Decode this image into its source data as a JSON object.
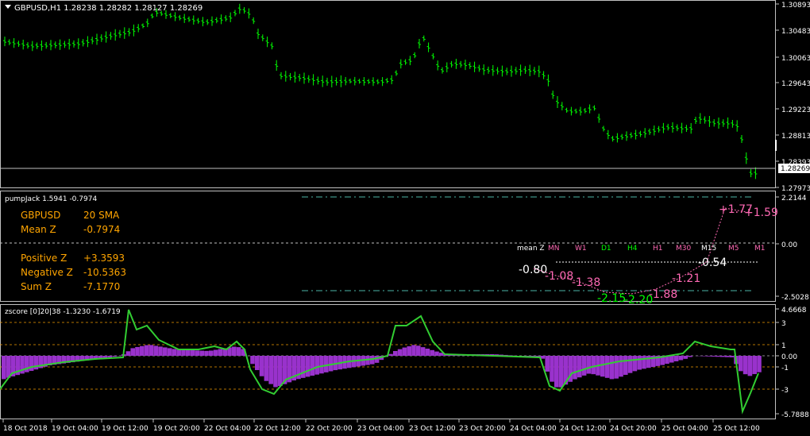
{
  "colors": {
    "background": "#000000",
    "candles": "#00ff00",
    "grid_border": "#c0c0c0",
    "orange_label": "#ffa500",
    "pink": "#ff69b4",
    "histogram": "#9932cc",
    "zscore_line": "#32cd32",
    "dashed_teal": "#4db3a6"
  },
  "main_chart": {
    "title": "GBPUSD,H1  1.28238 1.28282 1.28127 1.28269",
    "menu_icon": "triangle-down-icon",
    "price_ticks": [
      "1.30893",
      "1.30483",
      "1.30063",
      "1.29643",
      "1.29223",
      "1.28813",
      "1.28393",
      "1.27973"
    ],
    "current_price": "1.28269"
  },
  "pumpjack": {
    "title": "pumpJack 1.5941 -0.7974",
    "symbol": "GBPUSD",
    "sma": "20 SMA",
    "mean_label": "Mean Z",
    "mean_value": "-0.7974",
    "positive_label": "Positive Z",
    "positive_value": "+3.3593",
    "negative_label": "Negative Z",
    "negative_value": "-10.5363",
    "sum_label": "Sum Z",
    "sum_value": "-7.1770",
    "mean_z_header": "mean Z",
    "timeframes": [
      "MN",
      "W1",
      "D1",
      "H4",
      "H1",
      "M30",
      "M15",
      "M5",
      "M1"
    ],
    "mean_z_value": "-0.80",
    "tf_values": [
      "-1.08",
      "-1.38",
      "-2.15",
      "-2.20",
      "-1.88",
      "-1.21",
      "-0.54",
      "+1.77",
      "+1.59"
    ],
    "axis_ticks": [
      "2.2144",
      "0.00",
      "-2.5028"
    ]
  },
  "zscore": {
    "title": "zscore [0]20|38 -1.3230 -1.6719",
    "axis_ticks": [
      "4.6668",
      "3",
      "1",
      "0.00",
      "-1",
      "-3",
      "-5.7888"
    ]
  },
  "time_axis": [
    "18 Oct 2018",
    "19 Oct 04:00",
    "19 Oct 12:00",
    "19 Oct 20:00",
    "22 Oct 04:00",
    "22 Oct 12:00",
    "22 Oct 20:00",
    "23 Oct 04:00",
    "23 Oct 12:00",
    "23 Oct 20:00",
    "24 Oct 04:00",
    "24 Oct 12:00",
    "24 Oct 20:00",
    "25 Oct 04:00",
    "25 Oct 12:00"
  ]
}
